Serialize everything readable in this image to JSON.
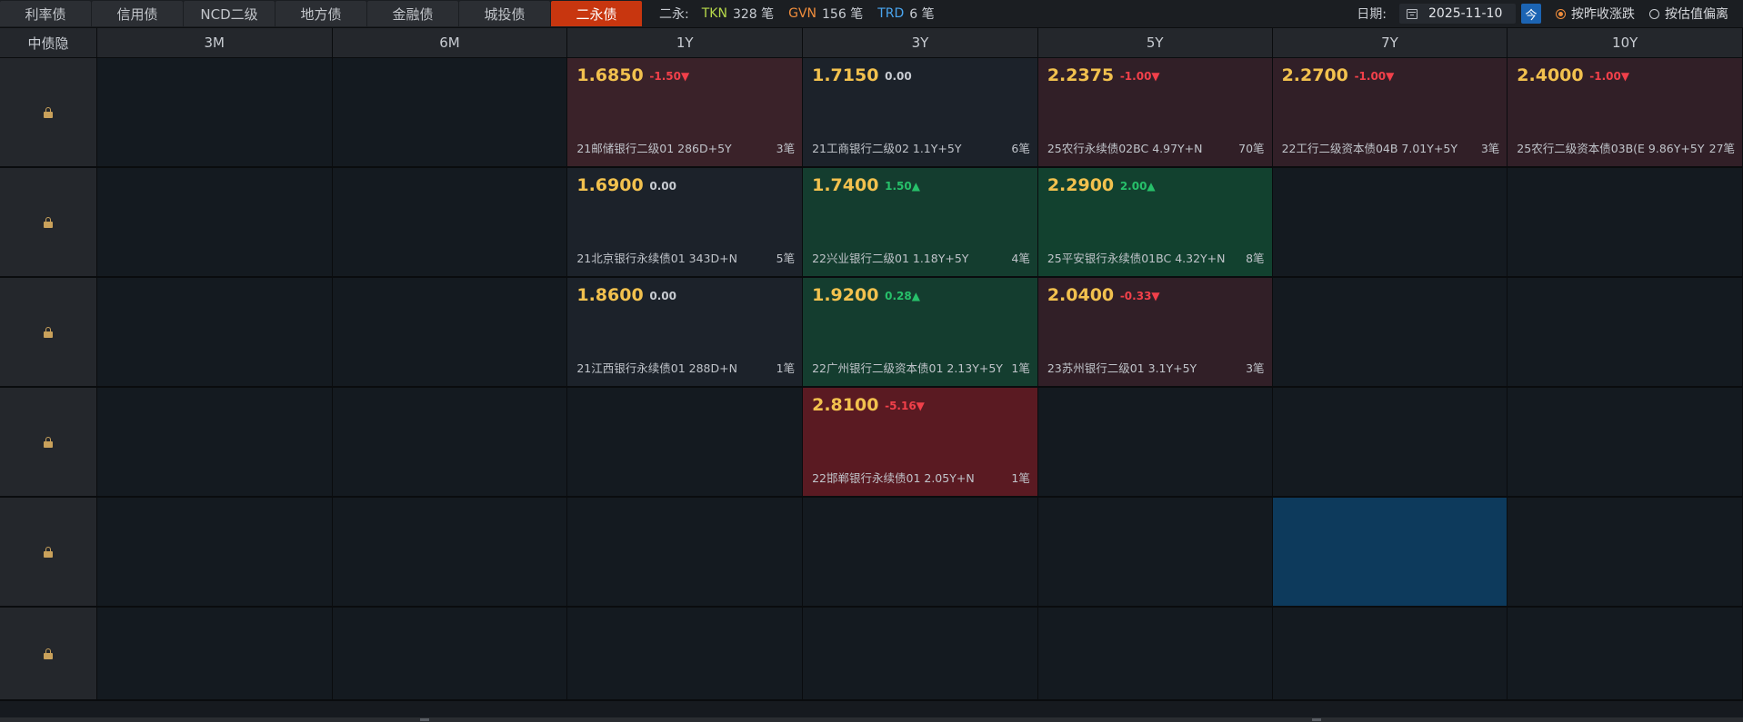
{
  "tabs": [
    {
      "label": "利率债",
      "active": false
    },
    {
      "label": "信用债",
      "active": false
    },
    {
      "label": "NCD二级",
      "active": false
    },
    {
      "label": "地方债",
      "active": false
    },
    {
      "label": "金融债",
      "active": false
    },
    {
      "label": "城投债",
      "active": false
    },
    {
      "label": "二永债",
      "active": true
    }
  ],
  "summary": {
    "prefix": "二永:",
    "tkn_label": "TKN",
    "tkn_count": "328 笔",
    "gvn_label": "GVN",
    "gvn_count": "156 笔",
    "trd_label": "TRD",
    "trd_count": "6 笔"
  },
  "controls": {
    "date_label": "日期:",
    "date_value": "2025-11-10",
    "today_label": "今",
    "radio_1": "按昨收涨跌",
    "radio_2": "按估值偏离",
    "radio_1_selected": true
  },
  "colors": {
    "active_tab": "#c8360f",
    "tkn": "#b6d84a",
    "gvn": "#f08d3c",
    "trd": "#4aa6f0",
    "price": "#f2c14e",
    "down": "#f1404a",
    "up": "#27c06a"
  },
  "grid": {
    "corner_label": "中债隐",
    "columns": [
      "3M",
      "6M",
      "1Y",
      "3Y",
      "5Y",
      "7Y",
      "10Y"
    ],
    "rows": [
      [
        null,
        null,
        {
          "price": "1.6850",
          "change": "-1.50▼",
          "dir": "down",
          "bond": "21邮储银行二级01 286D+5Y",
          "count": "3笔",
          "bg": "red"
        },
        {
          "price": "1.7150",
          "change": "0.00",
          "dir": "flat",
          "bond": "21工商银行二级02 1.1Y+5Y",
          "count": "6笔",
          "bg": "slate"
        },
        {
          "price": "2.2375",
          "change": "-1.00▼",
          "dir": "down",
          "bond": "25农行永续债02BC 4.97Y+N",
          "count": "70笔",
          "bg": "red2"
        },
        {
          "price": "2.2700",
          "change": "-1.00▼",
          "dir": "down",
          "bond": "22工行二级资本债04B 7.01Y+5Y",
          "count": "3笔",
          "bg": "red2"
        },
        {
          "price": "2.4000",
          "change": "-1.00▼",
          "dir": "down",
          "bond": "25农行二级资本债03B(E 9.86Y+5Y",
          "count": "27笔",
          "bg": "red2"
        }
      ],
      [
        null,
        null,
        {
          "price": "1.6900",
          "change": "0.00",
          "dir": "flat",
          "bond": "21北京银行永续债01 343D+N",
          "count": "5笔",
          "bg": "slate"
        },
        {
          "price": "1.7400",
          "change": "1.50▲",
          "dir": "up",
          "bond": "22兴业银行二级01 1.18Y+5Y",
          "count": "4笔",
          "bg": "green2"
        },
        {
          "price": "2.2900",
          "change": "2.00▲",
          "dir": "up",
          "bond": "25平安银行永续债01BC 4.32Y+N",
          "count": "8笔",
          "bg": "green"
        },
        null,
        null
      ],
      [
        null,
        null,
        {
          "price": "1.8600",
          "change": "0.00",
          "dir": "flat",
          "bond": "21江西银行永续债01 288D+N",
          "count": "1笔",
          "bg": "slate"
        },
        {
          "price": "1.9200",
          "change": "0.28▲",
          "dir": "up",
          "bond": "22广州银行二级资本债01 2.13Y+5Y",
          "count": "1笔",
          "bg": "green2"
        },
        {
          "price": "2.0400",
          "change": "-0.33▼",
          "dir": "down",
          "bond": "23苏州银行二级01 3.1Y+5Y",
          "count": "3笔",
          "bg": "red2"
        },
        null,
        null
      ],
      [
        null,
        null,
        null,
        {
          "price": "2.8100",
          "change": "-5.16▼",
          "dir": "down",
          "bond": "22邯郸银行永续债01 2.05Y+N",
          "count": "1笔",
          "bg": "deepred"
        },
        null,
        null,
        null
      ],
      [
        null,
        null,
        null,
        null,
        null,
        {
          "selected": true
        },
        null
      ],
      [
        null,
        null,
        null,
        null,
        null,
        null,
        null
      ]
    ]
  }
}
